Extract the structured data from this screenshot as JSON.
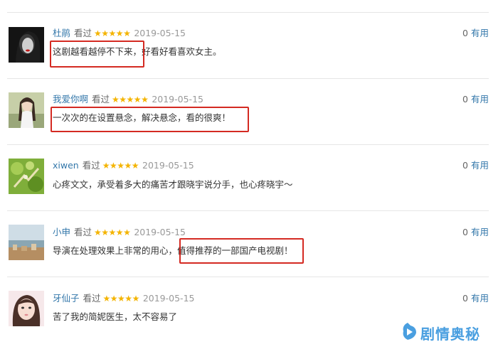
{
  "comments": [
    {
      "user": "杜鹃",
      "status": "看过",
      "rating": 5,
      "stars": "★★★★★",
      "date": "2019-05-15",
      "useful_count": "0",
      "useful_label": "有用",
      "content": "这剧越看越停不下来，好看好看喜欢女主。",
      "highlighted_text": "这剧越看越停不下来"
    },
    {
      "user": "我爱你啊",
      "status": "看过",
      "rating": 5,
      "stars": "★★★★★",
      "date": "2019-05-15",
      "useful_count": "0",
      "useful_label": "有用",
      "content": "一次次的在设置悬念，解决悬念，看的很爽！",
      "highlighted_text": "一次次的在设置悬念，解决悬念，看的很爽！"
    },
    {
      "user": "xiwen",
      "status": "看过",
      "rating": 5,
      "stars": "★★★★★",
      "date": "2019-05-15",
      "useful_count": "0",
      "useful_label": "有用",
      "content": "心疼文文，承受着多大的痛苦才跟晓宇说分手，也心疼晓宇～"
    },
    {
      "user": "小申",
      "status": "看过",
      "rating": 5,
      "stars": "★★★★★",
      "date": "2019-05-15",
      "useful_count": "0",
      "useful_label": "有用",
      "content": "导演在处理效果上非常的用心，值得推荐的一部国产电视剧！",
      "highlighted_text": "值得推荐的一部国产电视剧！"
    },
    {
      "user": "牙仙子",
      "status": "看过",
      "rating": 5,
      "stars": "★★★★★",
      "date": "2019-05-15",
      "useful_count": "0",
      "useful_label": "有用",
      "content": "苦了我的简妮医生，太不容易了"
    }
  ],
  "watermark": {
    "text": "剧情奥秘",
    "icon": "play-logo-icon",
    "color": "#4a9fe0"
  },
  "colors": {
    "link": "#3377aa",
    "star": "#f4b400",
    "highlight_box": "#d42a22",
    "date": "#999999"
  }
}
